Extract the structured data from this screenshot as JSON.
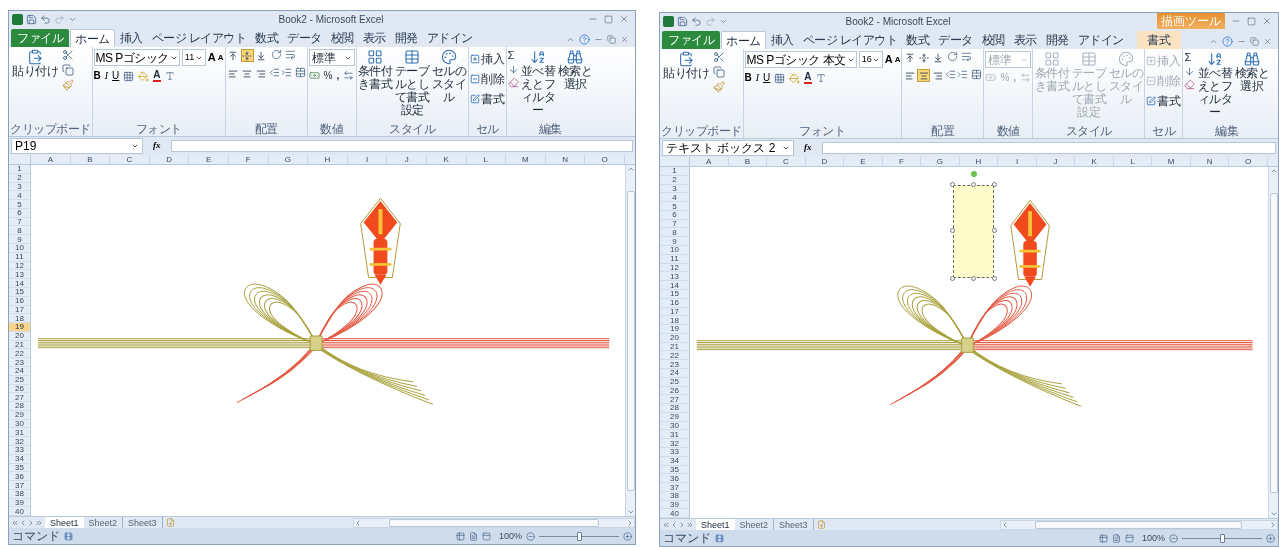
{
  "windows": [
    {
      "title": "Book2 - Microsoft Excel",
      "file_tab": "ファイル",
      "tabs": [
        {
          "label": "ホーム",
          "selected": true
        },
        {
          "label": "挿入",
          "selected": false
        },
        {
          "label": "ページ レイアウト",
          "selected": false
        },
        {
          "label": "数式",
          "selected": false
        },
        {
          "label": "データ",
          "selected": false
        },
        {
          "label": "校閲",
          "selected": false
        },
        {
          "label": "表示",
          "selected": false
        },
        {
          "label": "開発",
          "selected": false
        },
        {
          "label": "アドイン",
          "selected": false
        }
      ],
      "ribbon": {
        "clipboard": {
          "paste": "貼り付け",
          "label": "クリップボード"
        },
        "font": {
          "name": "MS Pゴシック",
          "size": "11",
          "grow": "A",
          "shrink": "A",
          "bold": "B",
          "italic": "I",
          "underline": "U",
          "font_color_button": "A",
          "label": "フォント"
        },
        "alignment": {
          "label": "配置",
          "top_row": [
            {
              "selected": false
            },
            {
              "selected": true
            },
            {
              "selected": false
            }
          ],
          "bottom_row": [
            {
              "selected": false
            },
            {
              "selected": false
            },
            {
              "selected": false
            }
          ]
        },
        "number": {
          "format": "標準",
          "percent": "%",
          "comma": ",",
          "label": "数値",
          "disabled": false
        },
        "styles": {
          "buttons": [
            "条件付き書式",
            "テーブルとして書式設定",
            "セルのスタイル"
          ],
          "label": "スタイル",
          "disabled": false
        },
        "cells": {
          "buttons": [
            {
              "label": "挿入",
              "disabled": false
            },
            {
              "label": "削除",
              "disabled": false
            },
            {
              "label": "書式",
              "disabled": false
            }
          ],
          "label": "セル"
        },
        "editing": {
          "sum": "Σ",
          "buttons": [
            "並べ替えとフィルター",
            "検索と選択"
          ],
          "label": "編集"
        }
      },
      "name_box": "P19",
      "function_label": "fx",
      "columns": [
        "A",
        "B",
        "C",
        "D",
        "E",
        "F",
        "G",
        "H",
        "I",
        "J",
        "K",
        "L",
        "M",
        "N",
        "O"
      ],
      "rows": [
        {
          "label": "1",
          "selected": false
        },
        {
          "label": "2",
          "selected": false
        },
        {
          "label": "3",
          "selected": false
        },
        {
          "label": "4",
          "selected": false
        },
        {
          "label": "5",
          "selected": false
        },
        {
          "label": "6",
          "selected": false
        },
        {
          "label": "7",
          "selected": false
        },
        {
          "label": "8",
          "selected": false
        },
        {
          "label": "9",
          "selected": false
        },
        {
          "label": "10",
          "selected": false
        },
        {
          "label": "11",
          "selected": false
        },
        {
          "label": "12",
          "selected": false
        },
        {
          "label": "13",
          "selected": false
        },
        {
          "label": "14",
          "selected": false
        },
        {
          "label": "15",
          "selected": false
        },
        {
          "label": "16",
          "selected": false
        },
        {
          "label": "17",
          "selected": false
        },
        {
          "label": "18",
          "selected": false
        },
        {
          "label": "19",
          "selected": true
        },
        {
          "label": "20",
          "selected": false
        },
        {
          "label": "21",
          "selected": false
        },
        {
          "label": "22",
          "selected": false
        },
        {
          "label": "23",
          "selected": false
        },
        {
          "label": "24",
          "selected": false
        },
        {
          "label": "25",
          "selected": false
        },
        {
          "label": "26",
          "selected": false
        },
        {
          "label": "27",
          "selected": false
        },
        {
          "label": "28",
          "selected": false
        },
        {
          "label": "29",
          "selected": false
        },
        {
          "label": "30",
          "selected": false
        },
        {
          "label": "31",
          "selected": false
        },
        {
          "label": "32",
          "selected": false
        },
        {
          "label": "33",
          "selected": false
        },
        {
          "label": "34",
          "selected": false
        },
        {
          "label": "35",
          "selected": false
        },
        {
          "label": "36",
          "selected": false
        },
        {
          "label": "37",
          "selected": false
        },
        {
          "label": "38",
          "selected": false
        },
        {
          "label": "39",
          "selected": false
        },
        {
          "label": "40",
          "selected": false
        }
      ],
      "sheet_tabs": [
        {
          "label": "Sheet1",
          "selected": true
        },
        {
          "label": "Sheet2",
          "selected": false
        },
        {
          "label": "Sheet3",
          "selected": false
        }
      ],
      "status": {
        "mode": "コマンド",
        "zoom": "100%",
        "zoom_slider": {
          "level": 0.5
        }
      }
    },
    {
      "title": "Book2 - Microsoft Excel",
      "file_tab": "ファイル",
      "context_tab": {
        "group": "描画ツール",
        "label": "書式",
        "selected": false
      },
      "tabs": [
        {
          "label": "ホーム",
          "selected": true
        },
        {
          "label": "挿入",
          "selected": false
        },
        {
          "label": "ページ レイアウト",
          "selected": false
        },
        {
          "label": "数式",
          "selected": false
        },
        {
          "label": "データ",
          "selected": false
        },
        {
          "label": "校閲",
          "selected": false
        },
        {
          "label": "表示",
          "selected": false
        },
        {
          "label": "開発",
          "selected": false
        },
        {
          "label": "アドイン",
          "selected": false
        }
      ],
      "ribbon": {
        "clipboard": {
          "paste": "貼り付け",
          "label": "クリップボード"
        },
        "font": {
          "name": "MS Pゴシック 本文",
          "size": "16",
          "grow": "A",
          "shrink": "A",
          "bold": "B",
          "italic": "I",
          "underline": "U",
          "font_color_button": "A",
          "label": "フォント"
        },
        "alignment": {
          "label": "配置",
          "top_row": [
            {
              "selected": false
            },
            {
              "selected": false
            },
            {
              "selected": false
            }
          ],
          "bottom_row": [
            {
              "selected": false
            },
            {
              "selected": true
            },
            {
              "selected": false
            }
          ]
        },
        "number": {
          "format": "標準",
          "percent": "%",
          "comma": ",",
          "label": "数値",
          "disabled": true
        },
        "styles": {
          "buttons": [
            "条件付き書式",
            "テーブルとして書式設定",
            "セルのスタイル"
          ],
          "label": "スタイル",
          "disabled": true
        },
        "cells": {
          "buttons": [
            {
              "label": "挿入",
              "disabled": true
            },
            {
              "label": "削除",
              "disabled": true
            },
            {
              "label": "書式",
              "disabled": false
            }
          ],
          "label": "セル"
        },
        "editing": {
          "sum": "Σ",
          "buttons": [
            "並べ替えとフィルター",
            "検索と選択"
          ],
          "label": "編集"
        }
      },
      "name_box": "テキスト ボックス 2",
      "function_label": "fx",
      "columns": [
        "A",
        "B",
        "C",
        "D",
        "E",
        "F",
        "G",
        "H",
        "I",
        "J",
        "K",
        "L",
        "M",
        "N",
        "O"
      ],
      "rows": [
        {
          "label": "1",
          "selected": false
        },
        {
          "label": "2",
          "selected": false
        },
        {
          "label": "3",
          "selected": false
        },
        {
          "label": "4",
          "selected": false
        },
        {
          "label": "5",
          "selected": false
        },
        {
          "label": "6",
          "selected": false
        },
        {
          "label": "7",
          "selected": false
        },
        {
          "label": "8",
          "selected": false
        },
        {
          "label": "9",
          "selected": false
        },
        {
          "label": "10",
          "selected": false
        },
        {
          "label": "11",
          "selected": false
        },
        {
          "label": "12",
          "selected": false
        },
        {
          "label": "13",
          "selected": false
        },
        {
          "label": "14",
          "selected": false
        },
        {
          "label": "15",
          "selected": false
        },
        {
          "label": "16",
          "selected": false
        },
        {
          "label": "17",
          "selected": false
        },
        {
          "label": "18",
          "selected": false
        },
        {
          "label": "19",
          "selected": false
        },
        {
          "label": "20",
          "selected": false
        },
        {
          "label": "21",
          "selected": false
        },
        {
          "label": "22",
          "selected": false
        },
        {
          "label": "23",
          "selected": false
        },
        {
          "label": "24",
          "selected": false
        },
        {
          "label": "25",
          "selected": false
        },
        {
          "label": "26",
          "selected": false
        },
        {
          "label": "27",
          "selected": false
        },
        {
          "label": "28",
          "selected": false
        },
        {
          "label": "29",
          "selected": false
        },
        {
          "label": "30",
          "selected": false
        },
        {
          "label": "31",
          "selected": false
        },
        {
          "label": "32",
          "selected": false
        },
        {
          "label": "33",
          "selected": false
        },
        {
          "label": "34",
          "selected": false
        },
        {
          "label": "35",
          "selected": false
        },
        {
          "label": "36",
          "selected": false
        },
        {
          "label": "37",
          "selected": false
        },
        {
          "label": "38",
          "selected": false
        },
        {
          "label": "39",
          "selected": false
        },
        {
          "label": "40",
          "selected": false
        }
      ],
      "text_box": {
        "selected": true
      },
      "sheet_tabs": [
        {
          "label": "Sheet1",
          "selected": true
        },
        {
          "label": "Sheet2",
          "selected": false
        },
        {
          "label": "Sheet3",
          "selected": false
        }
      ],
      "status": {
        "mode": "コマンド",
        "zoom": "100%",
        "zoom_slider": {
          "level": 0.5
        }
      }
    }
  ]
}
